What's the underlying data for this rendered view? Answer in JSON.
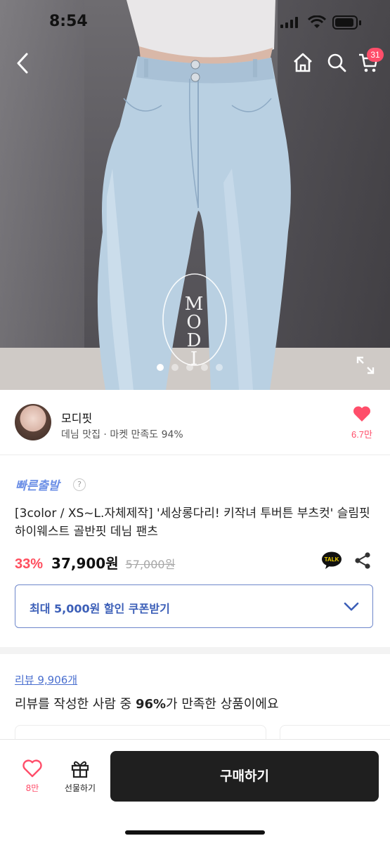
{
  "status_bar": {
    "time": "8:54"
  },
  "header": {
    "cart_count": "31"
  },
  "hero": {
    "watermark": "MODI",
    "carousel": {
      "total": 5,
      "active_index": 0
    }
  },
  "seller": {
    "name": "모디핏",
    "meta": "데님 맛집 · 마켓 만족도 94%",
    "like_count": "6.7만"
  },
  "product": {
    "fast_shipping": "빠른출발",
    "help_mark": "?",
    "title": "[3color / XS~L.자체제작] '세상롱다리! 키작녀 투버튼 부츠컷' 슬림핏 하이웨스트 골반핏 데님 팬츠",
    "discount": "33%",
    "price": "37,900원",
    "original_price": "57,000원",
    "talk_label": "TALK"
  },
  "coupon": {
    "label": "최대 5,000원 할인 쿠폰받기"
  },
  "reviews": {
    "link": "리뷰 9,906개",
    "summary_prefix": "리뷰를 작성한 사람 중 ",
    "summary_percent": "96%",
    "summary_suffix": "가 만족한 상품이에요"
  },
  "bottom_bar": {
    "wish_count": "8만",
    "gift_label": "선물하기",
    "buy_label": "구매하기"
  },
  "colors": {
    "accent_pink": "#ff4e6a",
    "discount_red": "#ff4e5e",
    "link_blue": "#4a6fcf",
    "coupon_blue": "#3c5fb8",
    "buy_button": "#1f1f1f"
  },
  "icons": [
    "back-icon",
    "home-icon",
    "search-icon",
    "cart-icon",
    "expand-icon",
    "heart-icon",
    "kakaotalk-icon",
    "share-icon",
    "chevron-down-icon",
    "gift-icon"
  ]
}
